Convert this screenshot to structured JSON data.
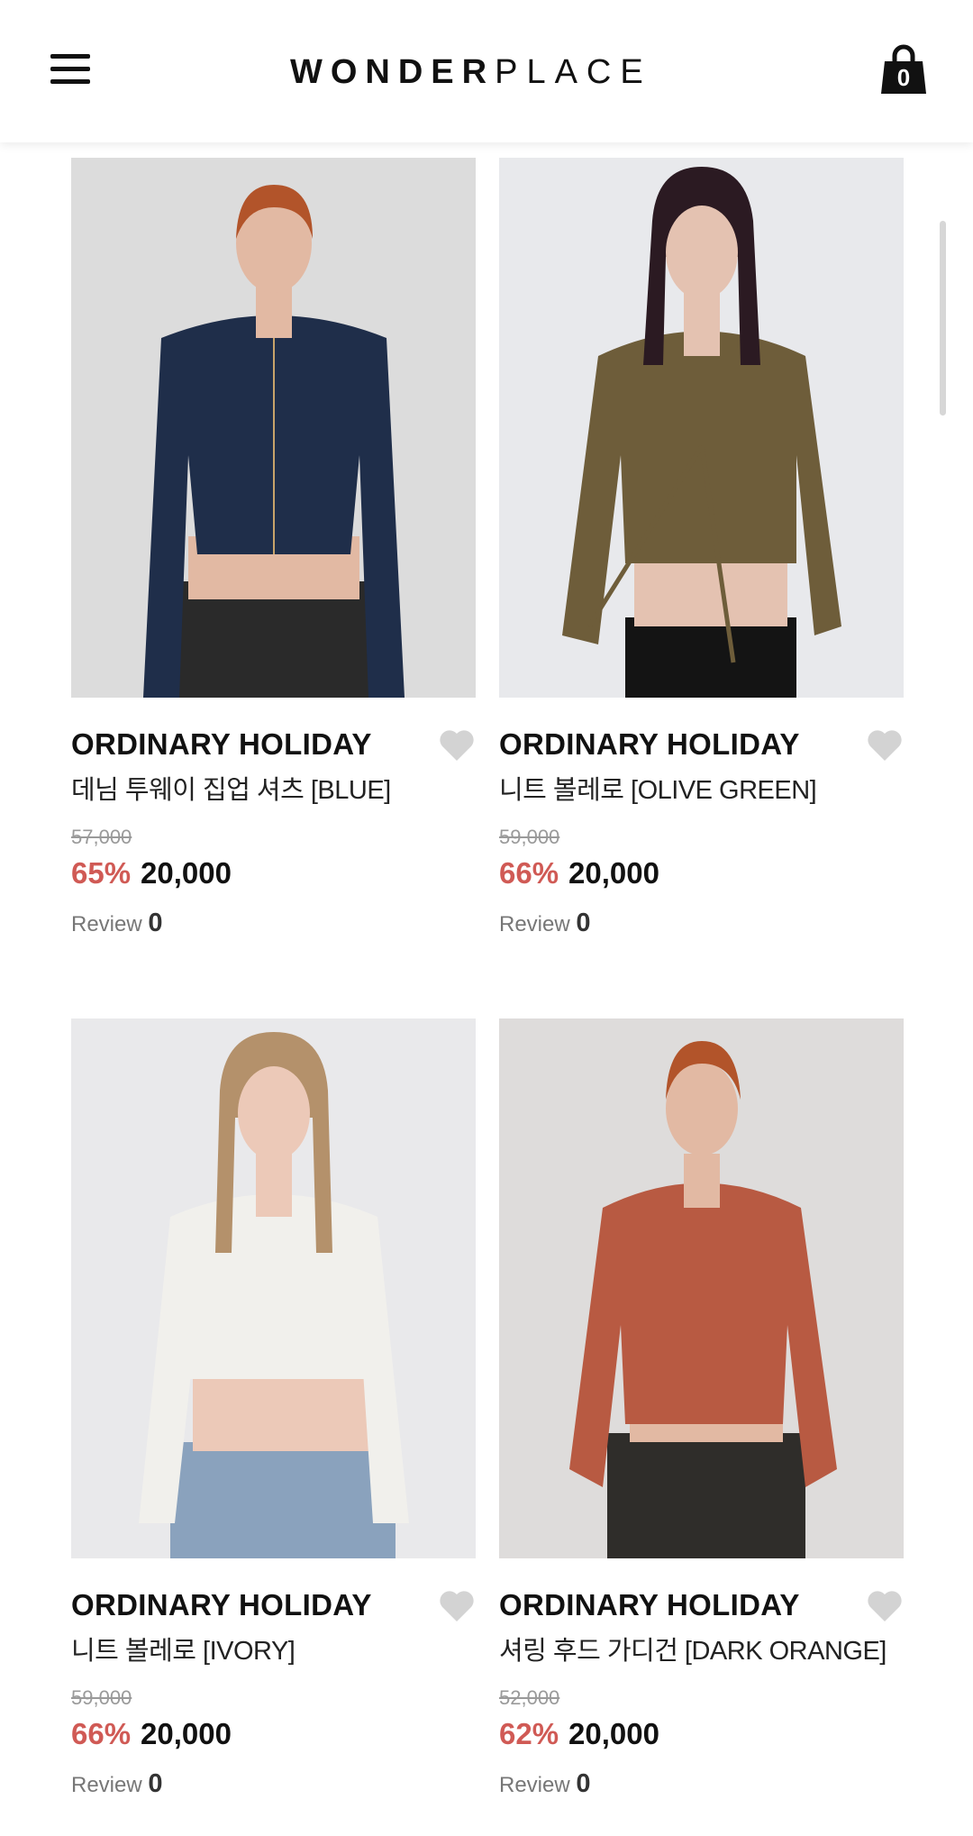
{
  "header": {
    "logo_bold": "WONDER",
    "logo_light": "PLACE",
    "cart_count": "0",
    "icons": [
      "menu-icon",
      "shopping-bag-icon"
    ]
  },
  "products": [
    {
      "brand": "ORDINARY HOLIDAY",
      "name": "데님 투웨이 집업 셔츠 [BLUE]",
      "original_price": "57,000",
      "discount": "65%",
      "price": "20,000",
      "review_label": "Review",
      "review_count": "0",
      "garment_color": "#1f2e4a"
    },
    {
      "brand": "ORDINARY HOLIDAY",
      "name": "니트 볼레로 [OLIVE GREEN]",
      "original_price": "59,000",
      "discount": "66%",
      "price": "20,000",
      "review_label": "Review",
      "review_count": "0",
      "garment_color": "#6e5d3a"
    },
    {
      "brand": "ORDINARY HOLIDAY",
      "name": "니트 볼레로 [IVORY]",
      "original_price": "59,000",
      "discount": "66%",
      "price": "20,000",
      "review_label": "Review",
      "review_count": "0",
      "garment_color": "#f1f0ec"
    },
    {
      "brand": "ORDINARY HOLIDAY",
      "name": "셔링 후드 가디건 [DARK ORANGE]",
      "original_price": "52,000",
      "discount": "62%",
      "price": "20,000",
      "review_label": "Review",
      "review_count": "0",
      "garment_color": "#b85a42"
    }
  ],
  "colors": {
    "discount": "#d05a55",
    "heart": "#d3d3d3"
  }
}
